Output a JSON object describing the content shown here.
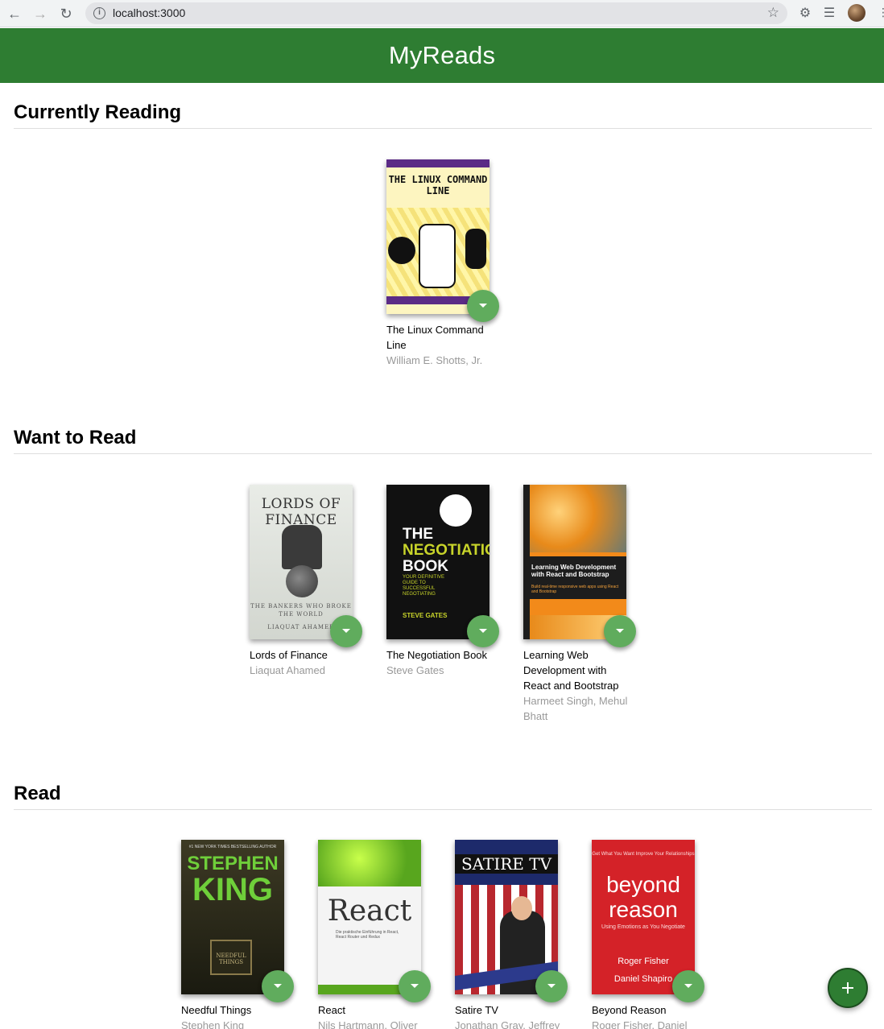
{
  "browser": {
    "url": "localhost:3000"
  },
  "app": {
    "title": "MyReads"
  },
  "shelves": [
    {
      "title": "Currently Reading",
      "books": [
        {
          "title": "The Linux Command Line",
          "authors": "William E. Shotts, Jr.",
          "cover_title": "THE LINUX COMMAND LINE"
        }
      ]
    },
    {
      "title": "Want to Read",
      "books": [
        {
          "title": "Lords of Finance",
          "authors": "Liaquat Ahamed",
          "cover_title": "LORDS OF FINANCE",
          "cover_subtitle": "THE BANKERS WHO BROKE THE WORLD",
          "cover_author": "LIAQUAT AHAMED"
        },
        {
          "title": "The Negotiation Book",
          "authors": "Steve Gates",
          "cover_line1": "THE",
          "cover_line2": "NEGOTIATION",
          "cover_line3": "BOOK",
          "cover_subtitle": "YOUR DEFINITIVE GUIDE TO SUCCESSFUL NEGOTIATING",
          "cover_author": "STEVE GATES"
        },
        {
          "title": "Learning Web Development with React and Bootstrap",
          "authors": "Harmeet Singh, Mehul Bhatt",
          "cover_title": "Learning Web Development with React and Bootstrap",
          "cover_subtitle": "Build real-time responsive web apps using React and Bootstrap"
        }
      ]
    },
    {
      "title": "Read",
      "books": [
        {
          "title": "Needful Things",
          "authors": "Stephen King",
          "cover_top": "#1 NEW YORK TIMES BESTSELLING AUTHOR",
          "cover_line1": "STEPHEN",
          "cover_line2": "KING",
          "cover_sign": "NEEDFUL THINGS"
        },
        {
          "title": "React",
          "authors": "Nils Hartmann, Oliver",
          "cover_title": "React",
          "cover_subtitle": "Die praktische Einführung in React, React Router und Redux"
        },
        {
          "title": "Satire TV",
          "authors": "Jonathan Gray, Jeffrey P",
          "cover_title": "SATIRE TV"
        },
        {
          "title": "Beyond Reason",
          "authors": "Roger Fisher, Daniel",
          "cover_top": "Get What You Want Improve Your Relationships",
          "cover_line1": "beyond",
          "cover_line2": "reason",
          "cover_subtitle": "Using Emotions as You Negotiate",
          "cover_author1": "Roger Fisher",
          "cover_author2": "Daniel Shapiro"
        }
      ]
    }
  ],
  "colors": {
    "header": "#2e7d32",
    "changer_button": "#60ac5d",
    "author_text": "#999999"
  },
  "icons": {
    "changer": "chevron-down-icon",
    "add": "plus-icon"
  }
}
